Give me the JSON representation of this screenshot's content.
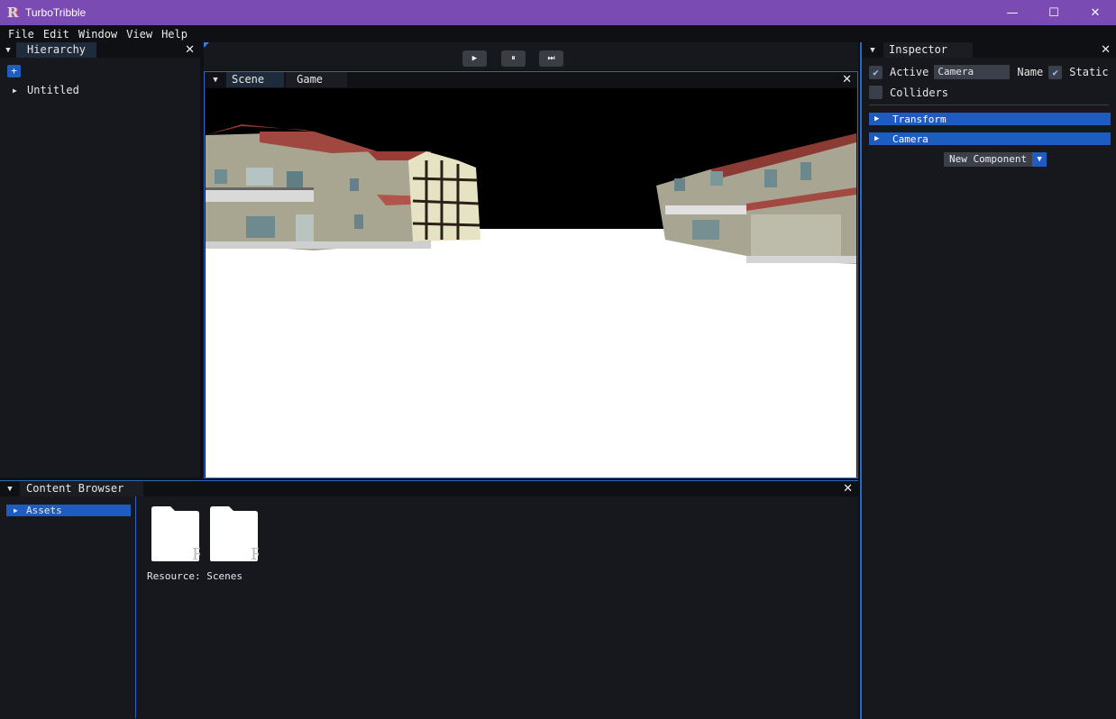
{
  "window": {
    "app_title": "TurboTribble",
    "logo_glyph": "R",
    "controls": {
      "minimize": "—",
      "maximize": "☐",
      "close": "✕"
    }
  },
  "menu": [
    "File",
    "Edit",
    "Window",
    "View",
    "Help"
  ],
  "hierarchy": {
    "tab": "Hierarchy",
    "add_label": "+",
    "items": [
      {
        "label": "Untitled"
      }
    ]
  },
  "toolbar": {
    "play": "▶",
    "pause": "⏸",
    "step": "⏭"
  },
  "scene_panel": {
    "tabs": [
      "Scene",
      "Game"
    ]
  },
  "inspector": {
    "tab": "Inspector",
    "active_label": "Active",
    "name_value": "Camera",
    "name_label": "Name",
    "static_label": "Static",
    "colliders_label": "Colliders",
    "active_checked": true,
    "static_checked": true,
    "colliders_checked": false,
    "components": [
      "Transform",
      "Camera"
    ],
    "new_component_label": "New Component"
  },
  "content_browser": {
    "tab": "Content Browser",
    "tree": [
      "Assets"
    ],
    "folders_caption": "Resource: Scenes"
  },
  "colors": {
    "titlebar": "#7a4bb3",
    "accent": "#1e5cc2",
    "panel_bg": "#16181d",
    "border_accent": "#2b66c2"
  }
}
